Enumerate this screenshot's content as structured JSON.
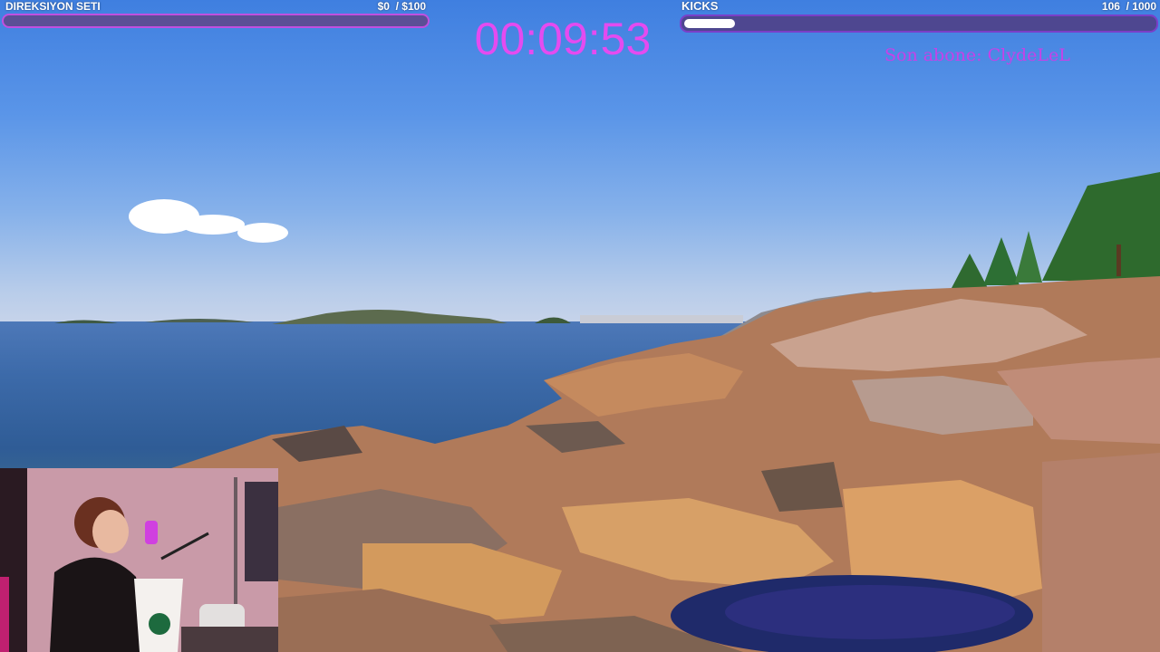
{
  "overlay": {
    "left_goal": {
      "title": "DIREKSIYON SETI",
      "current": "$0",
      "target": "/ $100",
      "progress": 0.0
    },
    "right_goal": {
      "title": "KICKS",
      "current": "106",
      "target": "/ 1000",
      "progress": 0.106
    },
    "timer": "00:09:53",
    "last_sub": "Son abone: ClydeLeL"
  },
  "colors": {
    "timer": "#e44bf0",
    "last_sub": "#c741e8",
    "bar_border_left": "#c14fe0",
    "bar_border_right": "#7a3fc8",
    "bar_track": "#5b4f96"
  },
  "scene": {
    "description_icons": [
      "cloud-icon",
      "tree-icon"
    ]
  }
}
